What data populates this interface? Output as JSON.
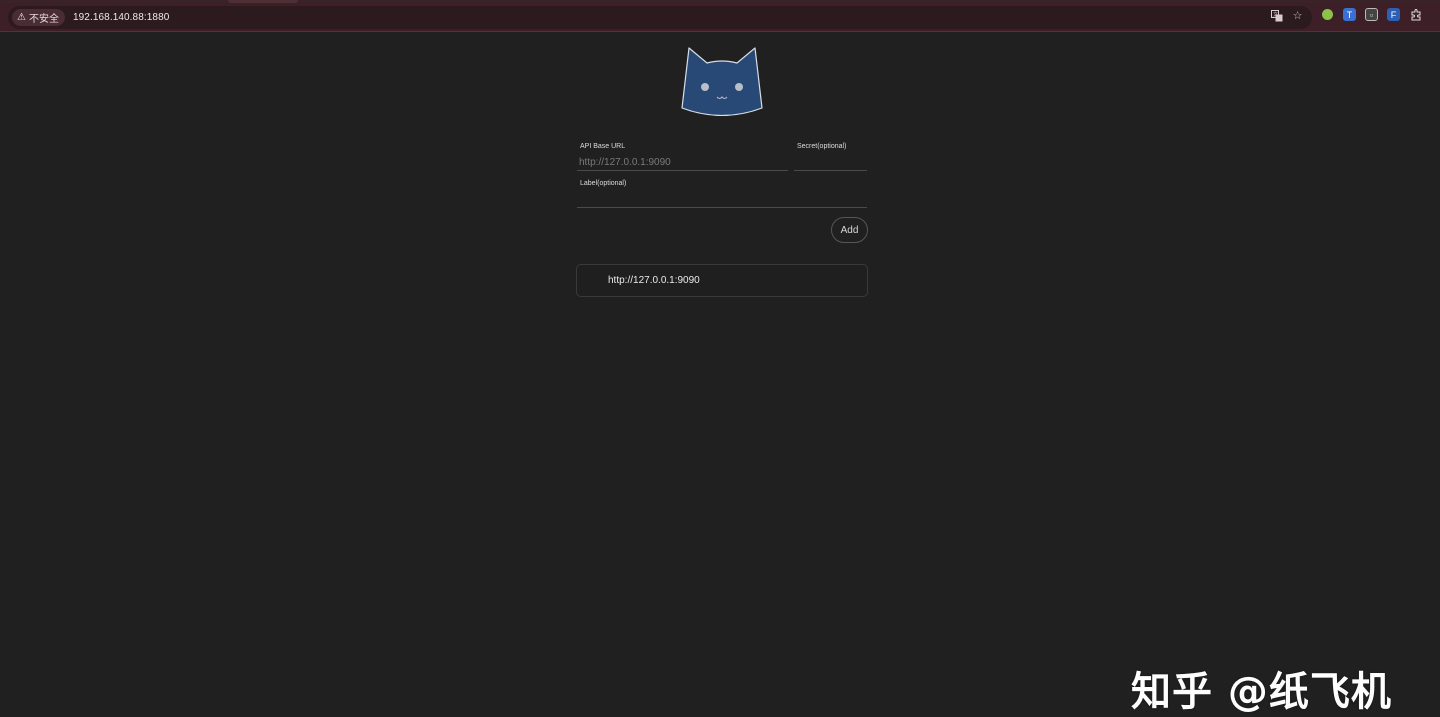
{
  "browser": {
    "security_label": "不安全",
    "url": "192.168.140.88:1880",
    "icons": [
      "translate-icon",
      "bookmark-star-icon"
    ],
    "extensions": [
      "green-dot-extension-icon",
      "translate-extension-icon",
      "media-extension-icon",
      "favorites-extension-icon",
      "extensions-puzzle-icon"
    ]
  },
  "form": {
    "api_base_url": {
      "label": "API Base URL",
      "placeholder": "http://127.0.0.1:9090",
      "value": ""
    },
    "secret": {
      "label": "Secret(optional)",
      "value": ""
    },
    "label": {
      "label": "Label(optional)",
      "value": ""
    },
    "add_label": "Add"
  },
  "servers": [
    {
      "url": "http://127.0.0.1:9090"
    }
  ],
  "logo": {
    "name": "cat-logo",
    "fill": "#284876",
    "stroke": "#d8dde6"
  },
  "watermark": "知乎 @纸飞机",
  "colors": {
    "background": "#202020",
    "toolbar": "#3d2027",
    "omnibox": "#2b1a1e"
  }
}
